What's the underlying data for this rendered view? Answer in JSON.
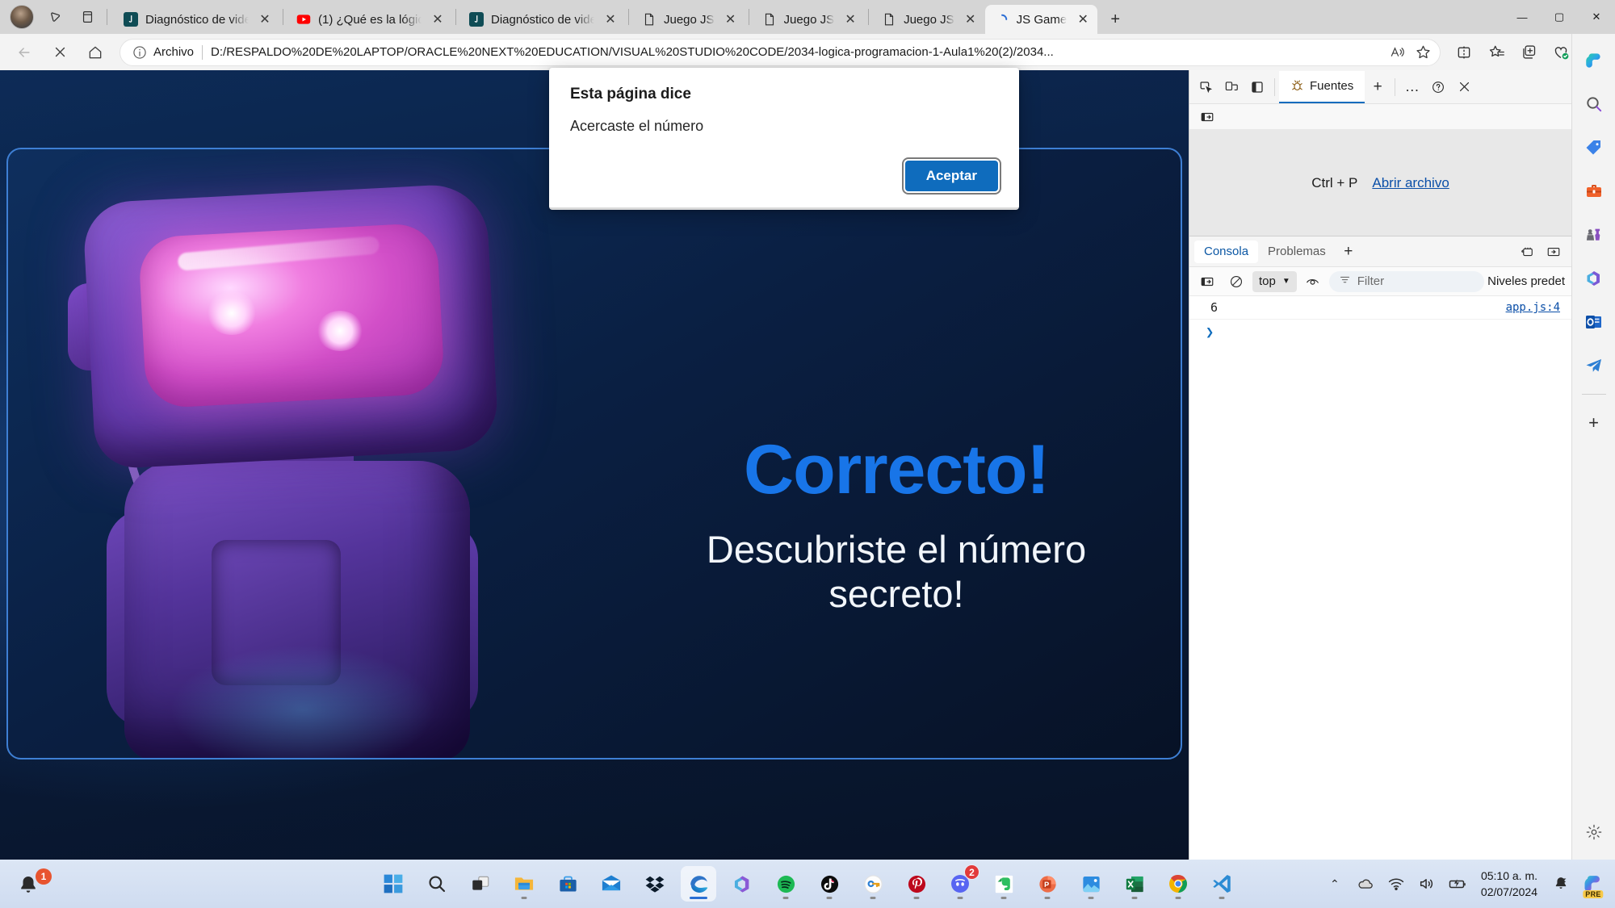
{
  "browser": {
    "tabs": [
      {
        "title": "Diagnóstico de vide",
        "favicon": "alura-icon",
        "active": false
      },
      {
        "title": "(1) ¿Qué es la lógica",
        "favicon": "youtube-icon",
        "active": false
      },
      {
        "title": "Diagnóstico de vide",
        "favicon": "alura-icon",
        "active": false
      },
      {
        "title": "Juego JS",
        "favicon": "file-icon",
        "active": false
      },
      {
        "title": "Juego JS",
        "favicon": "file-icon",
        "active": false
      },
      {
        "title": "Juego JS",
        "favicon": "file-icon",
        "active": false
      },
      {
        "title": "JS Game",
        "favicon": "js-loading-icon",
        "active": true
      }
    ],
    "tab_close_label": "✕",
    "new_tab_label": "+",
    "window_controls": {
      "minimize": "—",
      "maximize": "▢",
      "close": "✕"
    },
    "tabstrip_buttons": [
      {
        "name": "tab-actions-icon"
      },
      {
        "name": "copilot-collections-icon"
      },
      {
        "name": "split-screen-icon"
      }
    ],
    "nav": {
      "back_label": "←",
      "stop_label": "✕",
      "home_label": "home-icon"
    },
    "omnibox": {
      "scheme_label": "Archivo",
      "url": "D:/RESPALDO%20DE%20LAPTOP/ORACLE%20NEXT%20EDUCATION/VISUAL%20STUDIO%20CODE/2034-logica-programacion-1-Aula1%20(2)/2034...",
      "read_aloud_label": "A",
      "favorite_label": "☆"
    },
    "toolbar_buttons": [
      {
        "name": "split-screen-button"
      },
      {
        "name": "favorites-button"
      },
      {
        "name": "collections-button"
      },
      {
        "name": "browser-essentials-button"
      },
      {
        "name": "settings-and-more-button"
      }
    ]
  },
  "dialog": {
    "title": "Esta página dice",
    "message": "Acercaste el número",
    "accept_label": "Aceptar"
  },
  "page": {
    "title": "Correcto!",
    "subtitle": "Descubriste el número secreto!",
    "title_color": "#1875e8",
    "background_color": "#0a1a33"
  },
  "devtools": {
    "toolbar_icons": [
      {
        "name": "inspect-element-icon"
      },
      {
        "name": "device-emulation-icon"
      },
      {
        "name": "toggle-sidebar-icon"
      }
    ],
    "active_panel": "Fuentes",
    "add_panel_label": "+",
    "more_tools_label": "…",
    "help_label": "?",
    "close_label": "✕",
    "subbar_icon": "show-navigator-icon",
    "sources": {
      "shortcut": "Ctrl + P",
      "open_file_label": "Abrir archivo"
    },
    "drawer": {
      "tabs": [
        {
          "label": "Consola",
          "active": true
        },
        {
          "label": "Problemas",
          "active": false
        }
      ],
      "add_tab_label": "+",
      "right_icons": [
        {
          "name": "console-settings-icon"
        },
        {
          "name": "dock-side-icon"
        }
      ],
      "console_toolbar": {
        "sidebar_icon": "console-sidebar-icon",
        "clear_icon": "clear-console-icon",
        "context": "top",
        "context_caret": "▼",
        "eye_icon": "live-expression-icon",
        "filter_icon": "filter-icon",
        "filter_placeholder": "Filter",
        "levels_label": "Niveles predet"
      },
      "messages": [
        {
          "text": "6",
          "source": "app.js:4"
        }
      ],
      "prompt_caret": "❯"
    }
  },
  "edge_sidebar": {
    "items": [
      {
        "name": "copilot-icon"
      },
      {
        "name": "search-icon"
      },
      {
        "name": "shopping-tag-icon"
      },
      {
        "name": "tools-icon"
      },
      {
        "name": "games-icon"
      },
      {
        "name": "microsoft-365-icon"
      },
      {
        "name": "outlook-icon"
      },
      {
        "name": "telegram-icon"
      }
    ],
    "add_label": "+",
    "settings_name": "sidebar-settings-icon"
  },
  "taskbar": {
    "notification_count": "1",
    "items": [
      {
        "name": "start-button",
        "running": false
      },
      {
        "name": "search-button",
        "running": false
      },
      {
        "name": "task-view-button",
        "running": false
      },
      {
        "name": "file-explorer",
        "running": true
      },
      {
        "name": "microsoft-store",
        "running": false
      },
      {
        "name": "mail",
        "running": false
      },
      {
        "name": "dropbox",
        "running": false
      },
      {
        "name": "microsoft-edge",
        "running": true,
        "active": true
      },
      {
        "name": "microsoft-365",
        "running": false
      },
      {
        "name": "spotify",
        "running": true
      },
      {
        "name": "tiktok",
        "running": true
      },
      {
        "name": "password-manager",
        "running": true
      },
      {
        "name": "pinterest",
        "running": true
      },
      {
        "name": "discord",
        "running": true,
        "badge": "2"
      },
      {
        "name": "evernote",
        "running": true
      },
      {
        "name": "powerpoint",
        "running": true
      },
      {
        "name": "photos",
        "running": true
      },
      {
        "name": "excel",
        "running": true
      },
      {
        "name": "google-chrome",
        "running": true
      },
      {
        "name": "visual-studio-code",
        "running": true
      }
    ],
    "tray": {
      "chevron_label": "⌃",
      "icons": [
        {
          "name": "onedrive-icon"
        },
        {
          "name": "wifi-icon"
        },
        {
          "name": "volume-icon"
        },
        {
          "name": "battery-charging-icon"
        }
      ],
      "time": "05:10 a. m.",
      "date": "02/07/2024",
      "notifications_name": "notifications-bell-icon",
      "copilot_name": "copilot-tray-icon",
      "copilot_badge": "PRE"
    }
  }
}
